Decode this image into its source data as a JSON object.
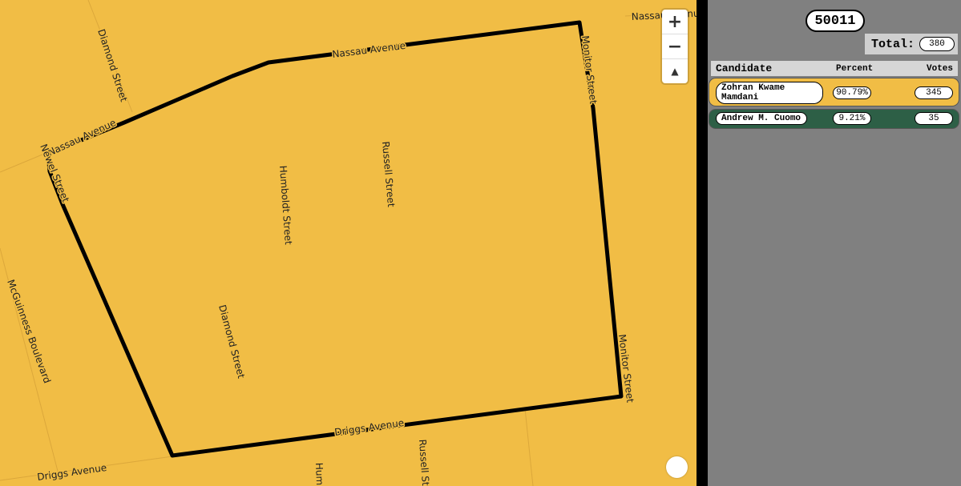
{
  "map": {
    "streets": {
      "nassau_top": "Nassau Avenue",
      "nassau_right": "Nassau Avenue",
      "nassau_left": "Nassau Avenue",
      "diamond_top": "Diamond Street",
      "diamond_bottom": "Diamond Street",
      "humboldt": "Humboldt Street",
      "humboldt_bottom": "Hum",
      "russell": "Russell Street",
      "russell_bottom": "Russell St",
      "newel": "Newel Street",
      "monitor_top": "Monitor Street",
      "monitor_bottom": "Monitor Street",
      "mcguinness": "McGuinness Boulevard",
      "driggs_center": "Driggs Avenue",
      "driggs_left": "Driggs Avenue"
    },
    "zoom_in_label": "+",
    "zoom_out_label": "−",
    "compass_label": "▲",
    "fill_color": "#f1bd45",
    "boundary_color": "#000000"
  },
  "panel": {
    "district": "50011",
    "total_label": "Total:",
    "total_value": "380",
    "columns": {
      "candidate": "Candidate",
      "percent": "Percent",
      "votes": "Votes"
    },
    "candidates": [
      {
        "name": "Zohran Kwame Mamdani",
        "percent": "90.79%",
        "votes": "345",
        "color": "#f1bd45"
      },
      {
        "name": "Andrew M. Cuomo",
        "percent": "9.21%",
        "votes": "35",
        "color": "#2d5f46"
      }
    ],
    "background_color": "#808080"
  }
}
